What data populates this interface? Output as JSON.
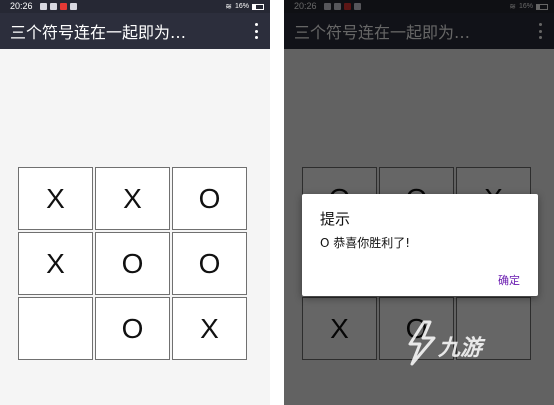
{
  "status_bar": {
    "time": "20:26",
    "battery": "16%"
  },
  "app_bar": {
    "title": "三个符号连在一起即为…"
  },
  "board_left": [
    [
      "X",
      "X",
      "O"
    ],
    [
      "X",
      "O",
      "O"
    ],
    [
      "",
      "O",
      "X"
    ]
  ],
  "board_right_visible": [
    [
      "O",
      "O",
      "X"
    ],
    [
      "",
      "",
      ""
    ],
    [
      "X",
      "O",
      ""
    ]
  ],
  "dialog": {
    "title": "提示",
    "message": "O 恭喜你胜利了!",
    "ok_label": "确定"
  },
  "watermark": {
    "text": "九游"
  },
  "colors": {
    "app_bar": "#2c2e3c",
    "status_bar": "#262834",
    "dialog_accent": "#6a1bb0"
  }
}
